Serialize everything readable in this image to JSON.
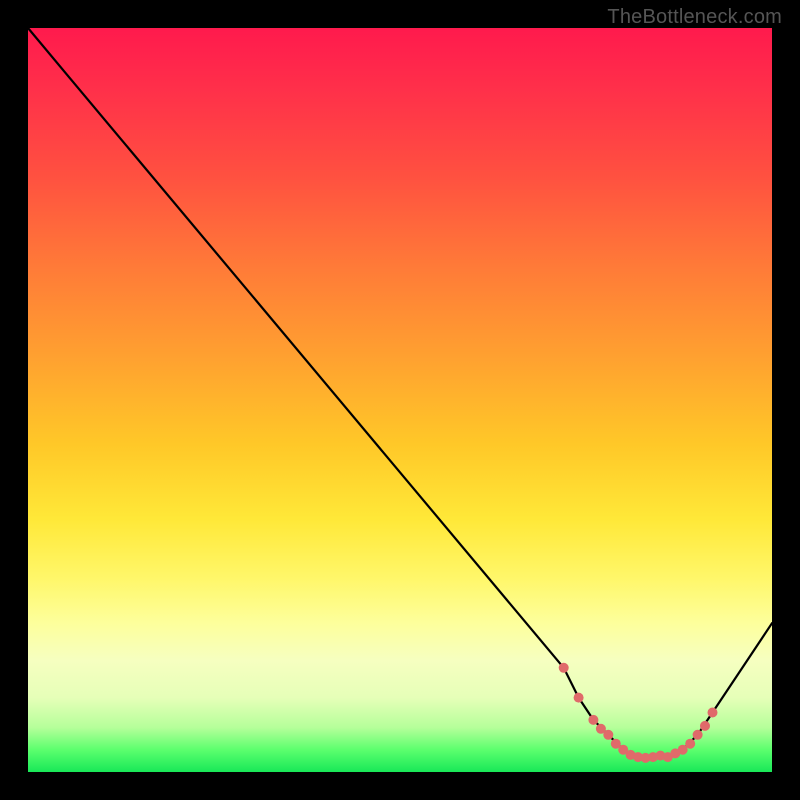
{
  "watermark": "TheBottleneck.com",
  "chart_data": {
    "type": "line",
    "title": "",
    "xlabel": "",
    "ylabel": "",
    "xlim": [
      0,
      100
    ],
    "ylim": [
      0,
      100
    ],
    "series": [
      {
        "name": "curve",
        "x": [
          0,
          5,
          72,
          74,
          76,
          78,
          80,
          82,
          84,
          86,
          88,
          90,
          92,
          100
        ],
        "y": [
          100,
          94,
          14,
          10,
          7,
          5,
          3,
          2,
          2,
          2,
          3,
          5,
          8,
          20
        ]
      }
    ],
    "markers": {
      "name": "points",
      "color": "#e06a6a",
      "radius": 5,
      "x": [
        72,
        74,
        76,
        77,
        78,
        79,
        80,
        81,
        82,
        83,
        84,
        85,
        86,
        87,
        88,
        89,
        90,
        91,
        92
      ],
      "y": [
        14,
        10,
        7,
        5.8,
        5,
        3.8,
        3,
        2.3,
        2,
        1.9,
        2,
        2.2,
        2,
        2.5,
        3,
        3.8,
        5,
        6.2,
        8
      ]
    }
  }
}
